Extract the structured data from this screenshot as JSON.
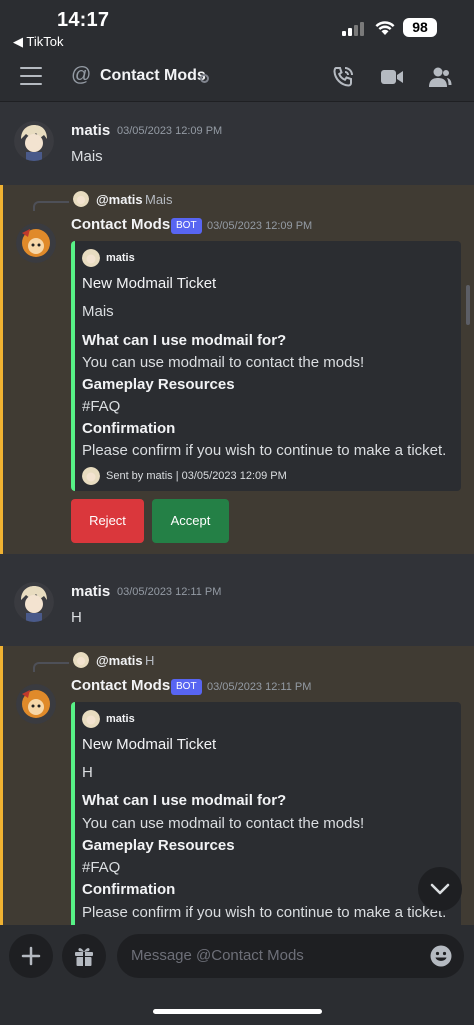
{
  "status_bar": {
    "time": "14:17",
    "back_label": "◀ TikTok",
    "battery": "98"
  },
  "header": {
    "channel_name": "Contact Mods"
  },
  "messages": [
    {
      "author": "matis",
      "timestamp": "03/05/2023 12:09 PM",
      "content": "Mais"
    },
    {
      "reply": {
        "author": "@matis",
        "text": "Mais"
      },
      "author": "Contact Mods",
      "tag": "BOT",
      "timestamp": "03/05/2023 12:09 PM",
      "embed": {
        "author": "matis",
        "title": "New Modmail Ticket",
        "description": "Mais",
        "field1_name": "What can I use modmail for?",
        "field1_value": "You can use modmail to contact the mods!",
        "field2_name": "Gameplay Resources",
        "field2_value": "#FAQ",
        "field3_name": "Confirmation",
        "field3_value": "Please confirm if you wish to continue to make a ticket.",
        "footer": "Sent by matis | 03/05/2023 12:09 PM"
      },
      "buttons": {
        "reject": "Reject",
        "accept": "Accept"
      }
    },
    {
      "author": "matis",
      "timestamp": "03/05/2023 12:11 PM",
      "content": "H"
    },
    {
      "reply": {
        "author": "@matis",
        "text": "H"
      },
      "author": "Contact Mods",
      "tag": "BOT",
      "timestamp": "03/05/2023 12:11 PM",
      "embed": {
        "author": "matis",
        "title": "New Modmail Ticket",
        "description": "H",
        "field1_name": "What can I use modmail for?",
        "field1_value": "You can use modmail to contact the mods!",
        "field2_name": "Gameplay Resources",
        "field2_value": "#FAQ",
        "field3_name": "Confirmation",
        "field3_value": "Please confirm if you wish to continue to make a ticket."
      }
    }
  ],
  "composer": {
    "placeholder": "Message @Contact Mods"
  },
  "colors": {
    "accent_bot": "#5865f2",
    "embed_border": "#57f287",
    "reject": "#da373c",
    "accept": "#248046",
    "highlight": "#f0b232"
  }
}
